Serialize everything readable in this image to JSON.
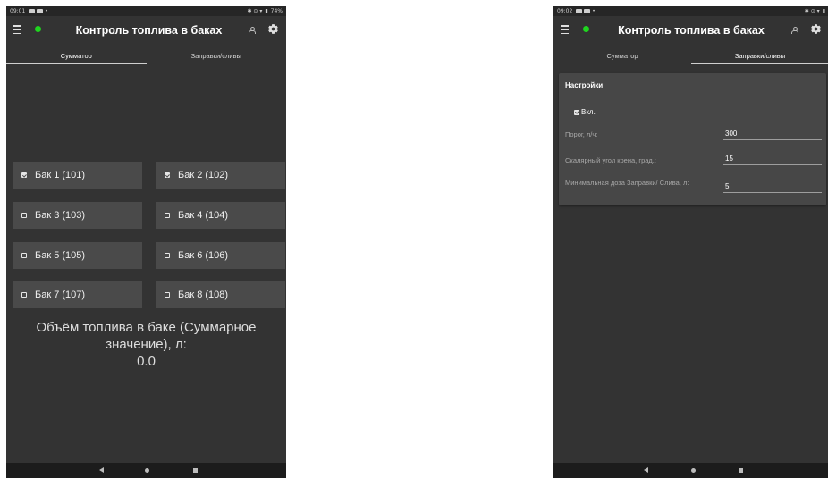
{
  "left_screen": {
    "status_time": "09:01",
    "status_battery": "74%",
    "title": "Контроль топлива в баках",
    "tabs": [
      {
        "label": "Сумматор",
        "active": true
      },
      {
        "label": "Заправки/сливы",
        "active": false
      }
    ],
    "tanks": [
      {
        "label": "Бак 1 (101)",
        "checked": true
      },
      {
        "label": "Бак 2 (102)",
        "checked": true
      },
      {
        "label": "Бак 3 (103)",
        "checked": false
      },
      {
        "label": "Бак 4 (104)",
        "checked": false
      },
      {
        "label": "Бак 5 (105)",
        "checked": false
      },
      {
        "label": "Бак 6 (106)",
        "checked": false
      },
      {
        "label": "Бак 7 (107)",
        "checked": false
      },
      {
        "label": "Бак 8 (108)",
        "checked": false
      }
    ],
    "volume_label_line1": "Объём топлива в баке (Суммарное",
    "volume_label_line2": "значение), л:",
    "volume_value": "0.0"
  },
  "right_screen": {
    "status_time": "09:02",
    "title": "Контроль топлива в баках",
    "tabs": [
      {
        "label": "Сумматор",
        "active": false
      },
      {
        "label": "Заправки/сливы",
        "active": true
      }
    ],
    "settings": {
      "title": "Настройки",
      "enabled_label": "Вкл.",
      "enabled": true,
      "fields": [
        {
          "label": "Порог, л/ч:",
          "value": "300"
        },
        {
          "label": "Скалярный угол крена, град.:",
          "value": "15"
        },
        {
          "label": "Минимальная доза Заправки/ Слива, л:",
          "value": "5"
        }
      ]
    }
  },
  "colors": {
    "screen_bg": "#333333",
    "tank_button_bg": "#4a4a4a",
    "card_bg": "#474747",
    "status_led": "#1fd51f"
  },
  "icons": [
    "menu-icon",
    "status-led",
    "person-icon",
    "gear-icon",
    "checkbox-icon",
    "nav-back-icon",
    "nav-home-icon",
    "nav-recent-icon"
  ]
}
